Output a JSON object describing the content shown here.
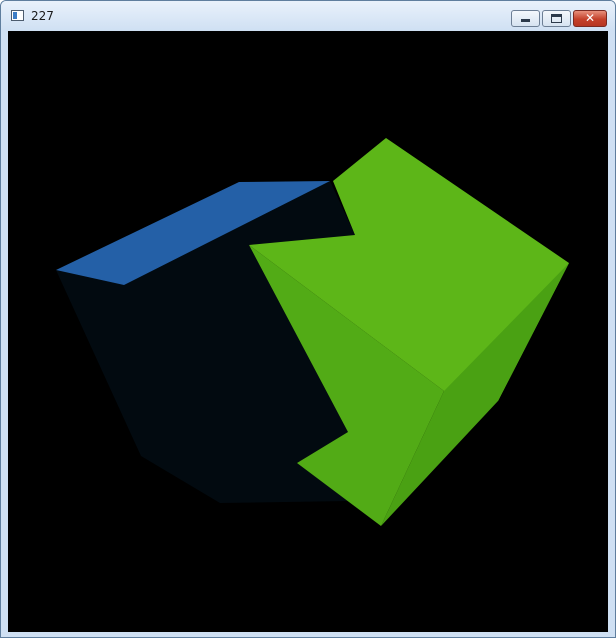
{
  "window": {
    "title": "227",
    "title_icon": "app-window-icon",
    "controls": {
      "minimize_icon": "minimize-icon",
      "maximize_icon": "maximize-icon",
      "close_icon": "close-icon",
      "close_glyph": "✕"
    }
  },
  "scene": {
    "background": "#000000",
    "dark_cube": {
      "top_face_color": "#2460a7",
      "front_face_color": "#020a10"
    },
    "green_cube": {
      "front_face_color": "#5db618",
      "left_shade_color": "#52ab16",
      "right_face_color": "#4aa113"
    }
  }
}
